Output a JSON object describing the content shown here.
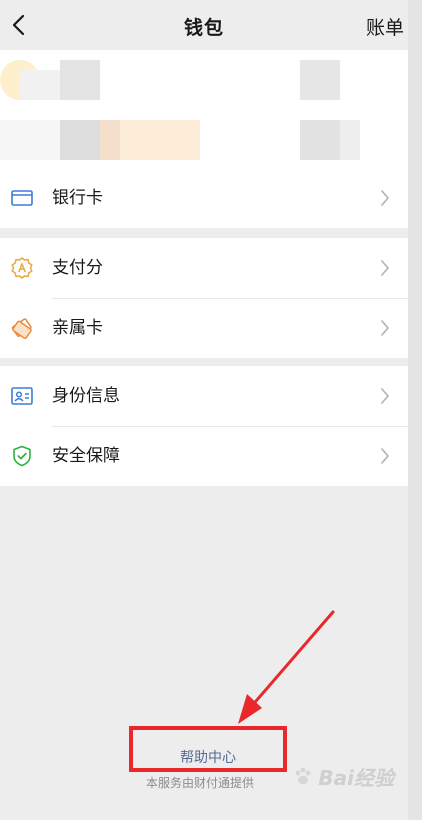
{
  "navbar": {
    "title": "钱包",
    "right_label": "账单",
    "back_icon": "chevron-left-icon"
  },
  "balance_card": {
    "blurred": true
  },
  "groups": [
    {
      "items": [
        {
          "label": "银行卡",
          "icon": "bank-card-icon",
          "icon_color": "#3c7bd8"
        }
      ]
    },
    {
      "items": [
        {
          "label": "支付分",
          "icon": "pay-score-icon",
          "icon_color": "#e9a73d"
        },
        {
          "label": "亲属卡",
          "icon": "family-card-icon",
          "icon_color": "#e9883d"
        }
      ]
    },
    {
      "items": [
        {
          "label": "身份信息",
          "icon": "id-card-icon",
          "icon_color": "#3c7bd8"
        },
        {
          "label": "安全保障",
          "icon": "shield-check-icon",
          "icon_color": "#2fb33f"
        }
      ]
    }
  ],
  "footer": {
    "help_label": "帮助中心",
    "provider_text": "本服务由财付通提供"
  },
  "annotation": {
    "arrow_color": "#e8282b",
    "box_color": "#e8282b"
  },
  "watermark": {
    "text": "Bai经验"
  },
  "colors": {
    "background": "#ededed",
    "card": "#ffffff",
    "link": "#576b95",
    "chevron": "#b2b2b2"
  }
}
